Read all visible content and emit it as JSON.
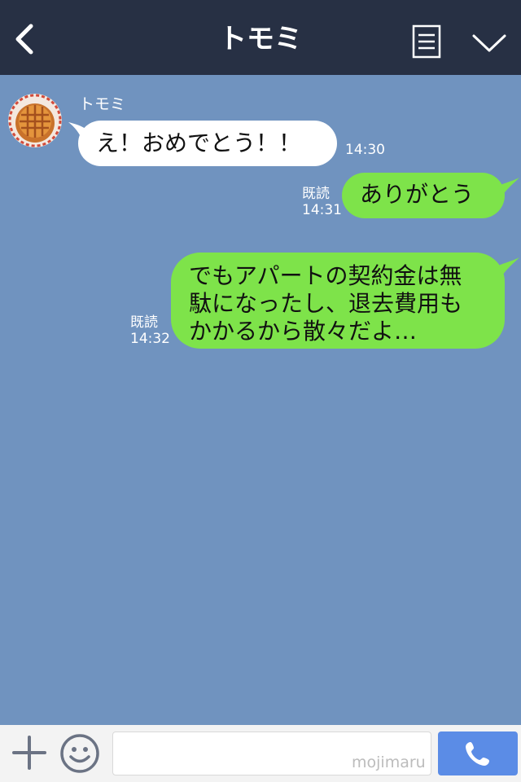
{
  "header": {
    "title": "トモミ",
    "back_icon": "chevron-left-icon",
    "menu_icon": "notes-icon",
    "collapse_icon": "chevron-down-icon",
    "background": "#273044"
  },
  "chat": {
    "background": "#7093bf",
    "messages": [
      {
        "direction": "received",
        "sender": "トモミ",
        "avatar": "pie-avatar",
        "text": "え！おめでとう！！",
        "time": "14:30"
      },
      {
        "direction": "sent",
        "text": "ありがとう",
        "read": "既読",
        "time": "14:31"
      },
      {
        "direction": "sent",
        "lines": [
          "でもアパートの契約金は無",
          "駄になったし、退去費用も",
          "かかるから散々だよ…"
        ],
        "read": "既読",
        "time": "14:32"
      }
    ],
    "bubble_colors": {
      "received": "#ffffff",
      "sent": "#7ee34a"
    }
  },
  "bottombar": {
    "plus_icon": "plus-icon",
    "emoji_icon": "smiley-icon",
    "input_placeholder": "",
    "input_value": "",
    "watermark": "mojimaru",
    "call_icon": "phone-icon",
    "call_button_color": "#5b8ce6"
  }
}
